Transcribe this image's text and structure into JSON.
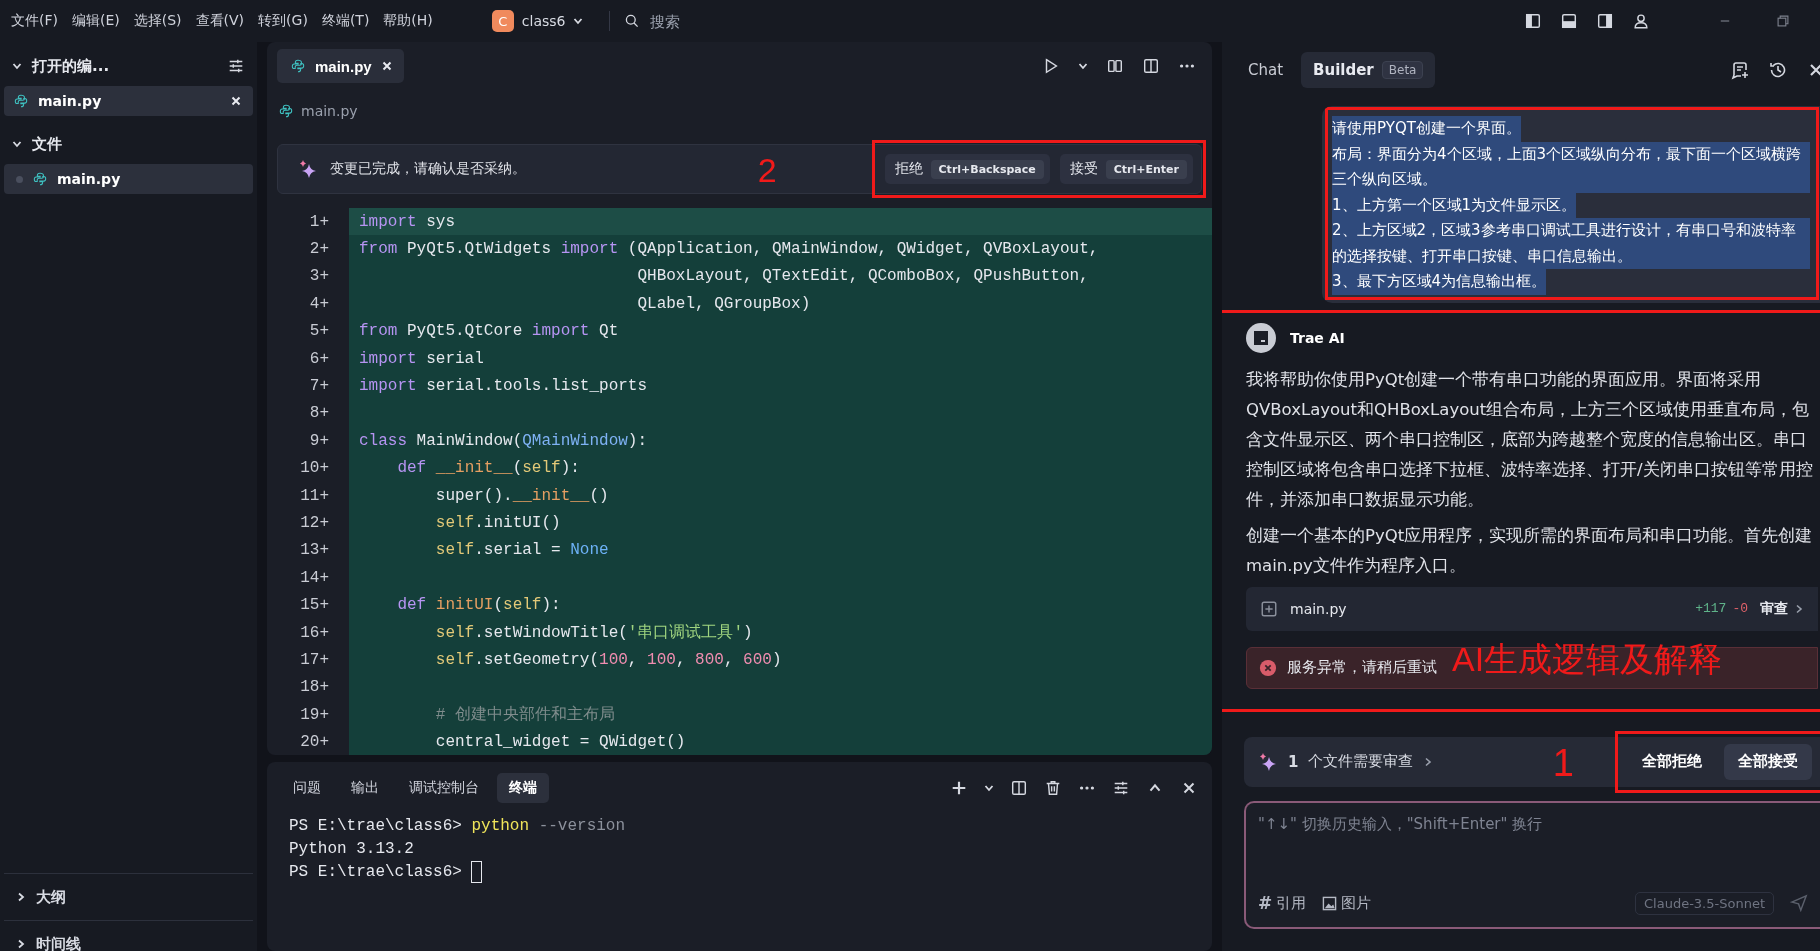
{
  "menu": [
    "文件(F)",
    "编辑(E)",
    "选择(S)",
    "查看(V)",
    "转到(G)",
    "终端(T)",
    "帮助(H)"
  ],
  "project": {
    "initial": "C",
    "name": "class6"
  },
  "search": {
    "placeholder": "搜索"
  },
  "sidebar": {
    "sections": [
      {
        "title": "打开的编...",
        "expanded": true,
        "items": [
          {
            "name": "main.py",
            "selected": true,
            "closable": true
          }
        ]
      },
      {
        "title": "文件",
        "expanded": true,
        "items": [
          {
            "name": "main.py",
            "selected": true,
            "closable": false
          }
        ]
      }
    ],
    "bottom_sections": [
      {
        "title": "大纲",
        "expanded": false
      },
      {
        "title": "时间线",
        "expanded": false
      }
    ]
  },
  "editor": {
    "tabs": [
      {
        "name": "main.py",
        "selected": true
      }
    ],
    "breadcrumb": "main.py",
    "notice": {
      "text": "变更已完成，请确认是否采纳。",
      "highlighted": true,
      "annotation": "2",
      "actions": [
        {
          "label": "拒绝",
          "shortcut": "Ctrl+Backspace"
        },
        {
          "label": "接受",
          "shortcut": "Ctrl+Enter"
        }
      ]
    },
    "lines": [
      {
        "number": "1+",
        "added": true,
        "current": true,
        "tokens": [
          {
            "t": "import",
            "kind": "kw"
          },
          {
            "t": " sys",
            "kind": "plain"
          }
        ]
      },
      {
        "number": "2+",
        "added": true,
        "current": false,
        "tokens": [
          {
            "t": "from",
            "kind": "kw"
          },
          {
            "t": " PyQt5.QtWidgets ",
            "kind": "plain"
          },
          {
            "t": "import",
            "kind": "kw"
          },
          {
            "t": " (QApplication, QMainWindow, QWidget, QVBoxLayout,",
            "kind": "plain"
          }
        ]
      },
      {
        "number": "3+",
        "added": true,
        "current": false,
        "tokens": [
          {
            "t": "                             QHBoxLayout, QTextEdit, QComboBox, QPushButton,",
            "kind": "plain"
          }
        ]
      },
      {
        "number": "4+",
        "added": true,
        "current": false,
        "tokens": [
          {
            "t": "                             QLabel, QGroupBox)",
            "kind": "plain"
          }
        ]
      },
      {
        "number": "5+",
        "added": true,
        "current": false,
        "tokens": [
          {
            "t": "from",
            "kind": "kw"
          },
          {
            "t": " PyQt5.QtCore ",
            "kind": "plain"
          },
          {
            "t": "import",
            "kind": "kw"
          },
          {
            "t": " Qt",
            "kind": "plain"
          }
        ]
      },
      {
        "number": "6+",
        "added": true,
        "current": false,
        "tokens": [
          {
            "t": "import",
            "kind": "kw"
          },
          {
            "t": " serial",
            "kind": "plain"
          }
        ]
      },
      {
        "number": "7+",
        "added": true,
        "current": false,
        "tokens": [
          {
            "t": "import",
            "kind": "kw"
          },
          {
            "t": " serial.tools.list_ports",
            "kind": "plain"
          }
        ]
      },
      {
        "number": "8+",
        "added": true,
        "current": false
      },
      {
        "number": "9+",
        "added": true,
        "current": false,
        "tokens": [
          {
            "t": "class",
            "kind": "kw"
          },
          {
            "t": " MainWindow(",
            "kind": "plain"
          },
          {
            "t": "QMainWindow",
            "kind": "cls"
          },
          {
            "t": "):",
            "kind": "plain"
          }
        ]
      },
      {
        "number": "10+",
        "added": true,
        "current": false,
        "tokens": [
          {
            "t": "    def",
            "kind": "kw"
          },
          {
            "t": " __init__",
            "kind": "fn"
          },
          {
            "t": "(",
            "kind": "plain"
          },
          {
            "t": "self",
            "kind": "self"
          },
          {
            "t": "):",
            "kind": "plain"
          }
        ]
      },
      {
        "number": "11+",
        "added": true,
        "current": false,
        "tokens": [
          {
            "t": "        super().",
            "kind": "plain"
          },
          {
            "t": "__init__",
            "kind": "fn"
          },
          {
            "t": "()",
            "kind": "plain"
          }
        ]
      },
      {
        "number": "12+",
        "added": true,
        "current": false,
        "tokens": [
          {
            "t": "        self",
            "kind": "self"
          },
          {
            "t": ".initUI()",
            "kind": "plain"
          }
        ]
      },
      {
        "number": "13+",
        "added": true,
        "current": false,
        "tokens": [
          {
            "t": "        self",
            "kind": "self"
          },
          {
            "t": ".serial = ",
            "kind": "plain"
          },
          {
            "t": "None",
            "kind": "const"
          }
        ]
      },
      {
        "number": "14+",
        "added": true,
        "current": false
      },
      {
        "number": "15+",
        "added": true,
        "current": false,
        "tokens": [
          {
            "t": "    def",
            "kind": "kw"
          },
          {
            "t": " initUI",
            "kind": "fn"
          },
          {
            "t": "(",
            "kind": "plain"
          },
          {
            "t": "self",
            "kind": "self"
          },
          {
            "t": "):",
            "kind": "plain"
          }
        ]
      },
      {
        "number": "16+",
        "added": true,
        "current": false,
        "tokens": [
          {
            "t": "        self",
            "kind": "self"
          },
          {
            "t": ".setWindowTitle(",
            "kind": "plain"
          },
          {
            "t": "'串口调试工具'",
            "kind": "str"
          },
          {
            "t": ")",
            "kind": "plain"
          }
        ]
      },
      {
        "number": "17+",
        "added": true,
        "current": false,
        "tokens": [
          {
            "t": "        self",
            "kind": "self"
          },
          {
            "t": ".setGeometry(",
            "kind": "plain"
          },
          {
            "t": "100",
            "kind": "num"
          },
          {
            "t": ", ",
            "kind": "plain"
          },
          {
            "t": "100",
            "kind": "num"
          },
          {
            "t": ", ",
            "kind": "plain"
          },
          {
            "t": "800",
            "kind": "num"
          },
          {
            "t": ", ",
            "kind": "plain"
          },
          {
            "t": "600",
            "kind": "num"
          },
          {
            "t": ")",
            "kind": "plain"
          }
        ]
      },
      {
        "number": "18+",
        "added": true,
        "current": false
      },
      {
        "number": "19+",
        "added": true,
        "current": false,
        "tokens": [
          {
            "t": "        # 创建中央部件和主布局",
            "kind": "comment"
          }
        ]
      },
      {
        "number": "20+",
        "added": true,
        "current": false,
        "tokens": [
          {
            "t": "        central_widget = QWidget()",
            "kind": "plain"
          }
        ]
      }
    ]
  },
  "panel": {
    "tabs": [
      {
        "label": "问题",
        "selected": false
      },
      {
        "label": "输出",
        "selected": false
      },
      {
        "label": "调试控制台",
        "selected": false
      },
      {
        "label": "终端",
        "selected": true
      }
    ],
    "terminal": [
      {
        "cursor": false,
        "tokens": [
          {
            "t": "PS E:\\trae\\class6> ",
            "kind": "plain"
          },
          {
            "t": "python",
            "kind": "cmd"
          },
          {
            "t": " --version",
            "kind": "arg"
          }
        ]
      },
      {
        "cursor": false,
        "tokens": [
          {
            "t": "Python 3.13.2",
            "kind": "plain"
          }
        ]
      },
      {
        "cursor": true,
        "tokens": [
          {
            "t": "PS E:\\trae\\class6> ",
            "kind": "plain"
          }
        ]
      }
    ]
  },
  "assistant": {
    "tabs": [
      {
        "label": "Chat",
        "selected": false
      },
      {
        "label": "Builder",
        "badge": "Beta",
        "selected": true
      }
    ],
    "user_message": {
      "highlighted": true,
      "lines": [
        {
          "text": "请使用PYQT创建一个界面。",
          "selected": true
        },
        {
          "text": "布局：界面分为4个区域，上面3个区域纵向分布，最下面一个区域横跨三个纵向区域。",
          "selected": true
        },
        {
          "text": "1、上方第一个区域1为文件显示区。",
          "selected": true
        },
        {
          "text": "2、上方区域2，区域3参考串口调试工具进行设计，有串口号和波特率的选择按键、打开串口按键、串口信息输出。",
          "selected": true
        },
        {
          "text": "3、最下方区域4为信息输出框。",
          "selected": true
        }
      ]
    },
    "reply": {
      "author": "Trae AI",
      "highlighted": true,
      "annotation": "AI生成逻辑及解释",
      "paragraphs": [
        "我将帮助你使用PyQt创建一个带有串口功能的界面应用。界面将采用QVBoxLayout和QHBoxLayout组合布局，上方三个区域使用垂直布局，包含文件显示区、两个串口控制区，底部为跨越整个宽度的信息输出区。串口控制区域将包含串口选择下拉框、波特率选择、打开/关闭串口按钮等常用控件，并添加串口数据显示功能。",
        "创建一个基本的PyQt应用程序，实现所需的界面布局和串口功能。首先创建main.py文件作为程序入口。"
      ],
      "file": {
        "name": "main.py",
        "added": "+117",
        "removed": "-0",
        "action": "审查"
      },
      "error": "服务异常，请稍后重试"
    },
    "review": {
      "count": "1",
      "text": "个文件需要审查",
      "highlighted": true,
      "annotation": "1",
      "buttons": [
        {
          "label": "全部拒绝",
          "primary": false
        },
        {
          "label": "全部接受",
          "primary": true
        }
      ]
    },
    "input": {
      "placeholder": "\"↑↓\" 切换历史输入，\"Shift+Enter\" 换行",
      "tools": [
        {
          "kind": "mention",
          "glyph": "#",
          "label": "引用"
        },
        {
          "kind": "image",
          "label": "图片"
        }
      ],
      "model": "Claude-3.5-Sonnet"
    }
  }
}
